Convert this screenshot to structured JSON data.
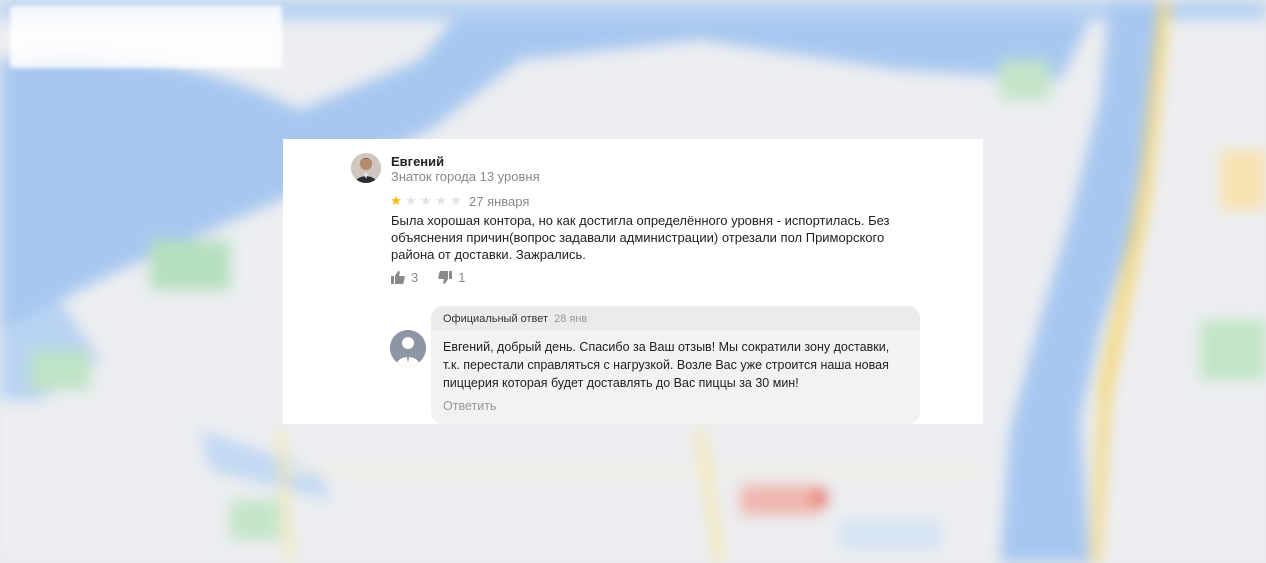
{
  "review": {
    "author_name": "Евгений",
    "author_level": "Знаток города 13 уровня",
    "rating": 1,
    "rating_max": 5,
    "date": "27 января",
    "text": "Была хорошая контора, но как достигла определённого уровня - испортилась. Без объяснения причин(вопрос задавали администрации) отрезали пол Приморского района от доставки. Зажрались.",
    "likes": "3",
    "dislikes": "1"
  },
  "reply": {
    "label": "Официальный ответ",
    "date": "28 янв",
    "text": "Евгений, добрый день. Спасибо за Ваш отзыв! Мы сократили зону доставки, т.к. перестали справляться с нагрузкой. Возле Вас уже строится наша новая пиццерия которая будет доставлять до Вас пиццы за 30 мин!",
    "reply_link": "Ответить"
  },
  "colors": {
    "star_on": "#fcb900",
    "star_off": "#e2e2e2",
    "water": "#a9c8f0",
    "land": "#eef0f2"
  }
}
